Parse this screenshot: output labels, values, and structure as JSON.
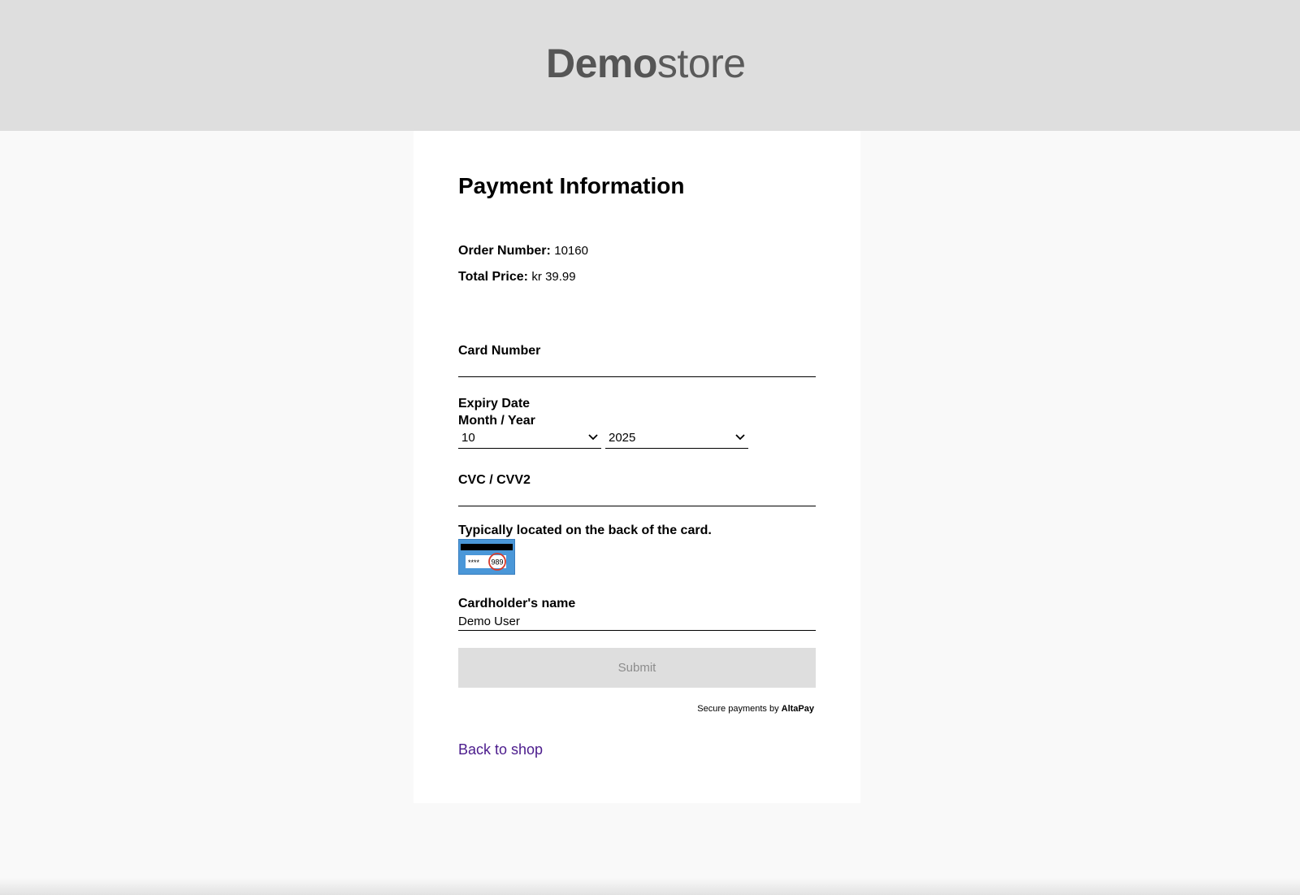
{
  "header": {
    "logo_bold": "Demo",
    "logo_light": "store"
  },
  "payment": {
    "title": "Payment Information",
    "order_number_label": "Order Number:",
    "order_number_value": "10160",
    "total_price_label": "Total Price:",
    "total_price_value": "kr 39.99"
  },
  "form": {
    "card_number_label": "Card Number",
    "card_number_value": "",
    "expiry_label": "Expiry Date",
    "expiry_sublabel": "Month / Year",
    "expiry_month": "10",
    "expiry_year": "2025",
    "cvc_label": "CVC / CVV2",
    "cvc_value": "",
    "cvc_hint": "Typically located on the back of the card.",
    "card_example_digits": "989",
    "cardholder_label": "Cardholder's name",
    "cardholder_value": "Demo User",
    "submit_label": "Submit"
  },
  "footer": {
    "secure_prefix": "Secure payments by",
    "secure_brand": "AltaPay",
    "back_link": "Back to shop"
  },
  "colors": {
    "header_bg": "#dedede",
    "page_bg": "#f9f9f9",
    "panel_bg": "#ffffff",
    "link": "#4b1b8c",
    "submit_bg": "#dedede",
    "card_blue": "#4a97d8"
  }
}
